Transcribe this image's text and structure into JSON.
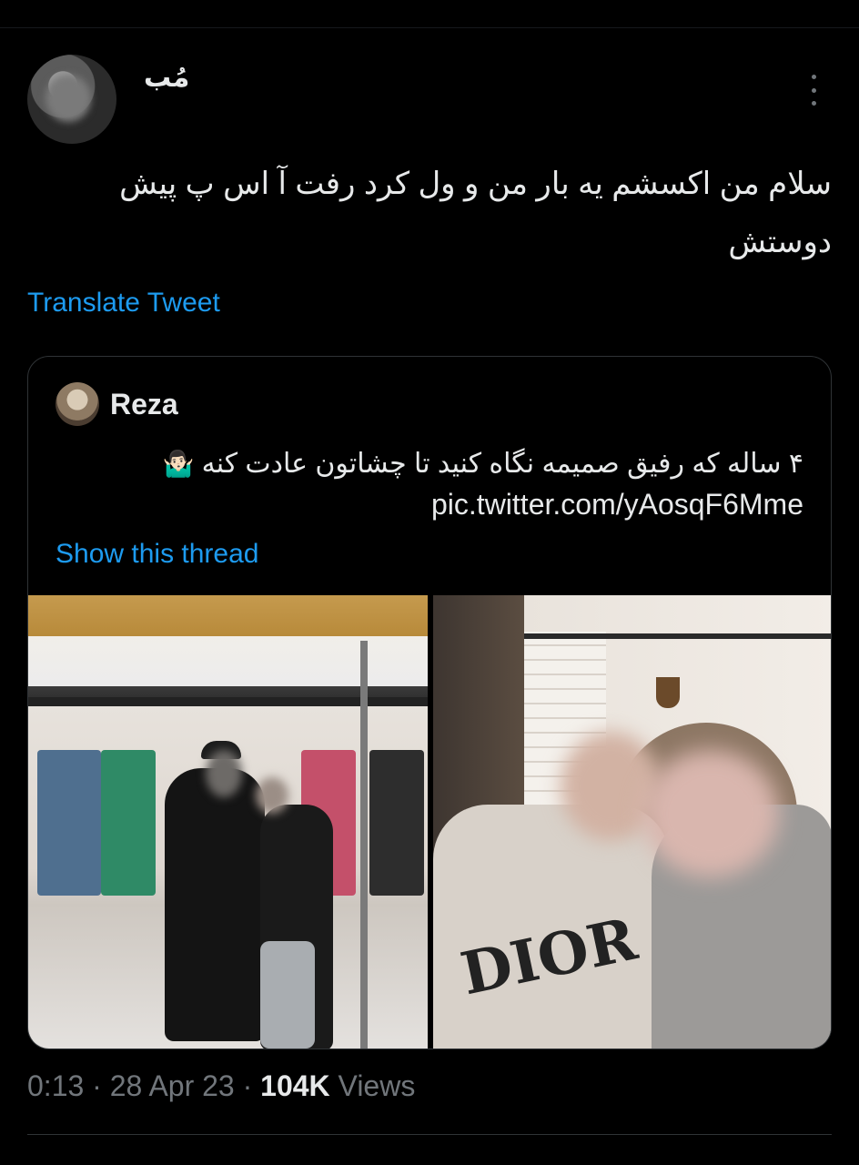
{
  "tweet": {
    "author_name": "مُب",
    "text_line1": "سلام من اکسشم یه بار من و ول کرد رفت آ اس پ پیش",
    "text_line2": "دوستش",
    "translate_label": "Translate Tweet"
  },
  "quote": {
    "author": "Reza",
    "text": "۴ ساله که رفیق صمیمه نگاه کنید تا چشاتون عادت کنه",
    "emoji": "🤷🏻‍♂️",
    "link": "pic.twitter.com/yAosqF6Mme",
    "show_thread_label": "Show this thread",
    "media_left_logo": "",
    "media_right_logo": "DIOR"
  },
  "meta": {
    "time": "0:13",
    "separator": "·",
    "date": "28 Apr 23",
    "views_count": "104K",
    "views_label": "Views"
  }
}
